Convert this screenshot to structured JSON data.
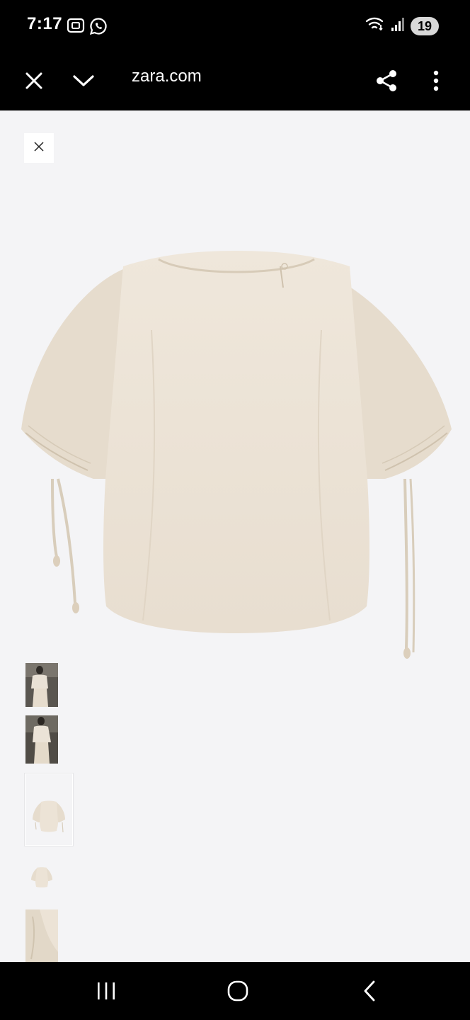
{
  "status_bar": {
    "time": "7:17",
    "battery": "19",
    "left_icons": [
      "screenshot-icon",
      "whatsapp-icon"
    ],
    "right_icons": [
      "wifi-icon",
      "signal-icon"
    ]
  },
  "browser": {
    "url": "zara.com",
    "icons": [
      "close-icon",
      "chevron-down-icon",
      "share-icon",
      "more-vertical-icon"
    ]
  },
  "product_viewer": {
    "close_icon": "close-icon",
    "main_image": "beige-drawstring-sleeve-top",
    "thumbnails": [
      {
        "name": "model-front-thumbnail",
        "selected": false
      },
      {
        "name": "model-side-thumbnail",
        "selected": false
      },
      {
        "name": "product-flat-thumbnail",
        "selected": true
      },
      {
        "name": "product-small-thumbnail",
        "selected": false
      },
      {
        "name": "sleeve-detail-thumbnail",
        "selected": false
      }
    ],
    "colors": {
      "background": "#f4f4f6",
      "garment": "#ece3d6",
      "garment_shadow": "#ddd2c2"
    }
  },
  "nav_bar": {
    "icons": [
      "recent-apps-icon",
      "home-icon",
      "back-icon"
    ]
  }
}
